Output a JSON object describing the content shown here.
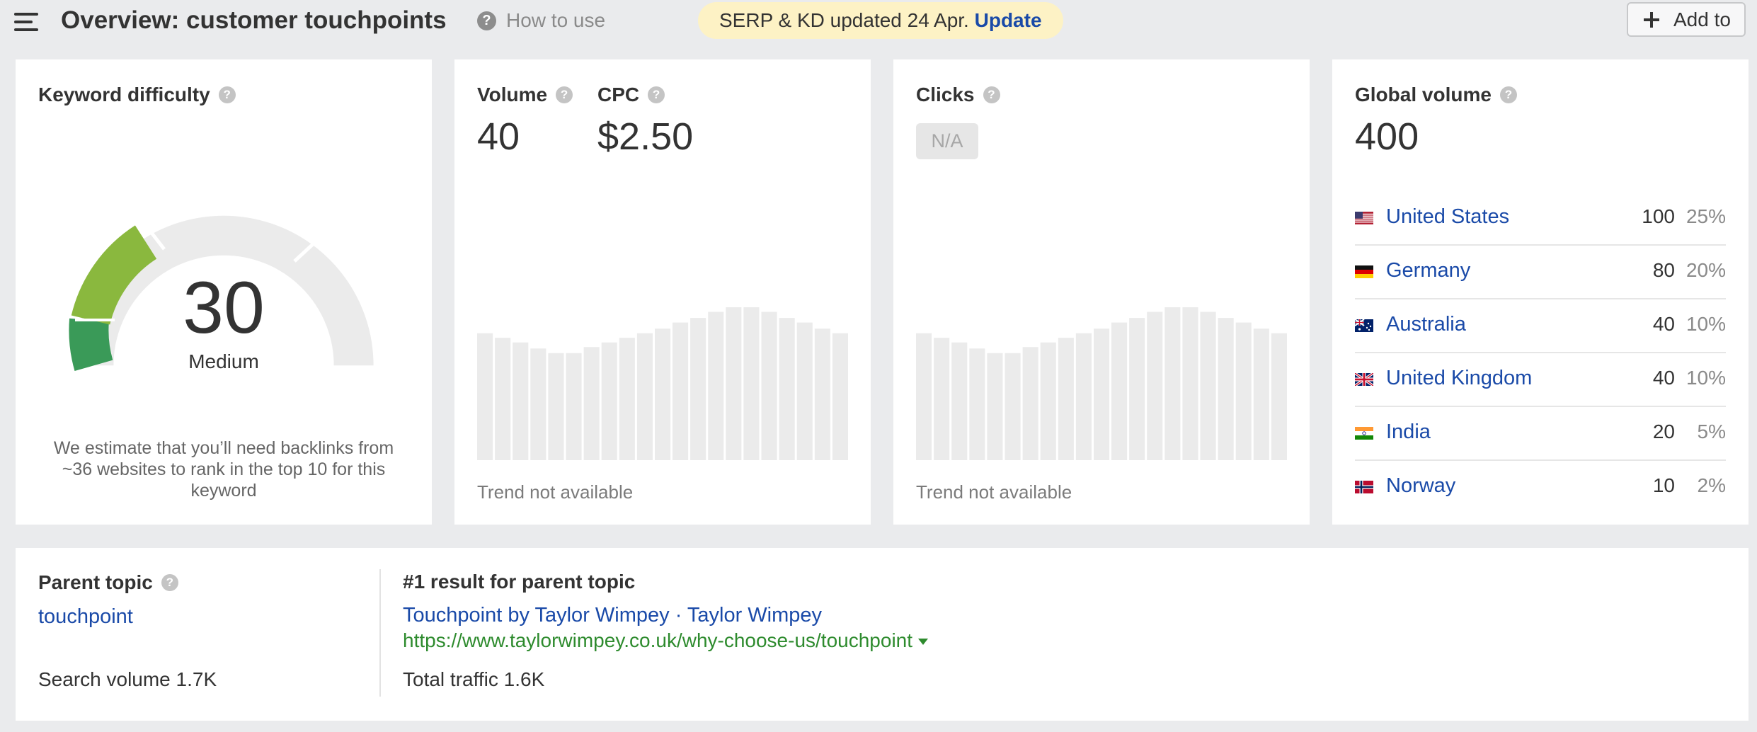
{
  "header": {
    "title": "Overview: customer touchpoints",
    "how_to_use": "How to use",
    "banner_text": "SERP & KD updated 24 Apr.",
    "banner_link": "Update",
    "add_to": "Add to"
  },
  "kd": {
    "title": "Keyword difficulty",
    "value": "30",
    "label": "Medium",
    "note": "We estimate that you’ll need backlinks from ~36 websites to rank in the top 10 for this keyword"
  },
  "volume": {
    "volume_title": "Volume",
    "volume_value": "40",
    "cpc_title": "CPC",
    "cpc_value": "$2.50",
    "trend_note": "Trend not available"
  },
  "clicks": {
    "title": "Clicks",
    "na": "N/A",
    "trend_note": "Trend not available"
  },
  "trend_placeholder": [
    0.83,
    0.8,
    0.77,
    0.73,
    0.7,
    0.7,
    0.74,
    0.77,
    0.8,
    0.83,
    0.86,
    0.9,
    0.93,
    0.97,
    1.0,
    1.0,
    0.97,
    0.93,
    0.9,
    0.86,
    0.83
  ],
  "global": {
    "title": "Global volume",
    "value": "400",
    "countries": [
      {
        "name": "United States",
        "volume": "100",
        "pct": "25%",
        "flag": "us-flag"
      },
      {
        "name": "Germany",
        "volume": "80",
        "pct": "20%",
        "flag": "de-flag"
      },
      {
        "name": "Australia",
        "volume": "40",
        "pct": "10%",
        "flag": "au-flag"
      },
      {
        "name": "United Kingdom",
        "volume": "40",
        "pct": "10%",
        "flag": "gb-flag"
      },
      {
        "name": "India",
        "volume": "20",
        "pct": "5%",
        "flag": "in-flag"
      },
      {
        "name": "Norway",
        "volume": "10",
        "pct": "2%",
        "flag": "no-flag"
      }
    ]
  },
  "parent_topic": {
    "title": "Parent topic",
    "link": "touchpoint",
    "search_volume": "Search volume 1.7K"
  },
  "top_result": {
    "title": "#1 result for parent topic",
    "link": "Touchpoint by Taylor Wimpey · Taylor Wimpey",
    "url": "https://www.taylorwimpey.co.uk/why-choose-us/touchpoint",
    "traffic": "Total traffic 1.6K"
  },
  "colors": {
    "link": "#1a4aa8",
    "url": "#2e8b2e",
    "banner_bg": "#fdf2c5",
    "kd_green_light": "#8ab83e",
    "kd_green_dark": "#3a9a58",
    "gauge_bg": "#ebebeb"
  }
}
